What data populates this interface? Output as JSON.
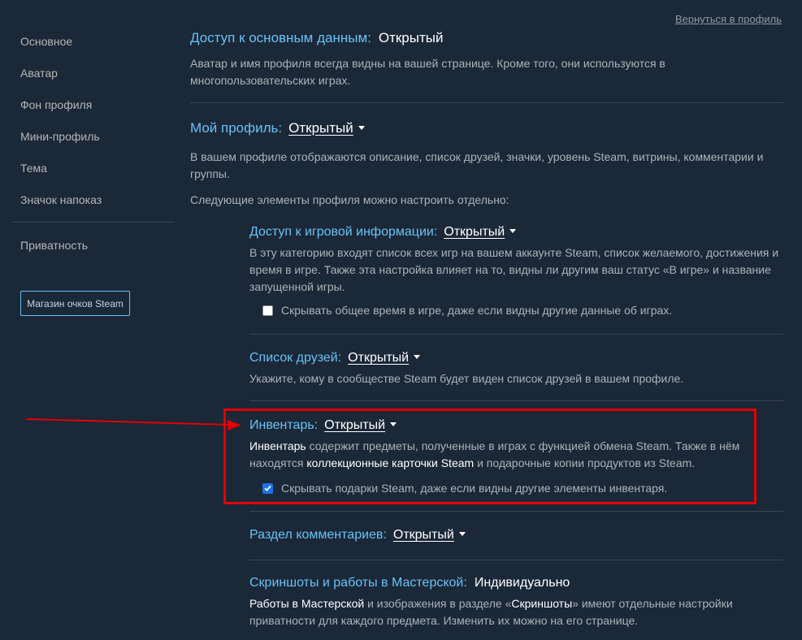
{
  "sidebar": {
    "items": [
      {
        "label": "Основное"
      },
      {
        "label": "Аватар"
      },
      {
        "label": "Фон профиля"
      },
      {
        "label": "Мини-профиль"
      },
      {
        "label": "Тема"
      },
      {
        "label": "Значок напоказ"
      },
      {
        "label": "Приватность"
      }
    ],
    "points_shop_label": "Магазин очков Steam"
  },
  "header": {
    "back_link": "Вернуться в профиль"
  },
  "basic": {
    "title": "Доступ к основным данным:",
    "value": "Открытый",
    "desc": "Аватар и имя профиля всегда видны на вашей странице. Кроме того, они используются в многопользовательских играх."
  },
  "profile": {
    "title": "Мой профиль:",
    "value": "Открытый",
    "desc": "В вашем профиле отображаются описание, список друзей, значки, уровень Steam, витрины, комментарии и группы.",
    "note": "Следующие элементы профиля можно настроить отдельно:"
  },
  "game_details": {
    "title": "Доступ к игровой информации:",
    "value": "Открытый",
    "desc": "В эту категорию входят список всех игр на вашем аккаунте Steam, список желаемого, достижения и время в игре. Также эта настройка влияет на то, видны ли другим ваш статус «В игре» и название запущенной игры.",
    "checkbox_label": "Скрывать общее время в игре, даже если видны другие данные об играх.",
    "checkbox_checked": false
  },
  "friends": {
    "title": "Список друзей:",
    "value": "Открытый",
    "desc": "Укажите, кому в сообществе Steam будет виден список друзей в вашем профиле."
  },
  "inventory": {
    "title": "Инвентарь:",
    "value": "Открытый",
    "desc_b1": "Инвентарь",
    "desc_t1": " содержит предметы, полученные в играх с функцией обмена Steam. Также в нём находятся ",
    "desc_b2": "коллекционные карточки Steam",
    "desc_t2": " и подарочные копии продуктов из Steam.",
    "checkbox_label": "Скрывать подарки Steam, даже если видны другие элементы инвентаря.",
    "checkbox_checked": true
  },
  "comments": {
    "title": "Раздел комментариев:",
    "value": "Открытый"
  },
  "screenshots": {
    "title": "Скриншоты и работы в Мастерской:",
    "value": "Индивидуально",
    "desc_b1": "Работы в Мастерской",
    "desc_t1": " и изображения в разделе «",
    "desc_b2": "Скриншоты",
    "desc_t2": "» имеют отдельные настройки приватности для каждого предмета. Изменить их можно на его странице."
  },
  "colors": {
    "background": "#1b2838",
    "accent": "#67c1f5",
    "highlight": "#e30000",
    "checkbox_on": "#1a73e8"
  }
}
